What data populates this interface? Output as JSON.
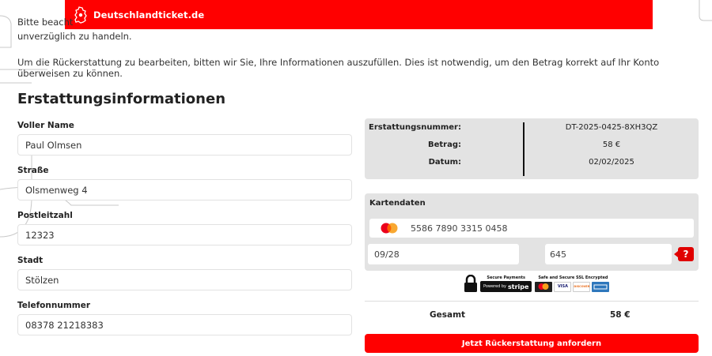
{
  "header": {
    "brand": "Deutschlandticket.de"
  },
  "intro": {
    "line1": "Bitte beacht",
    "line2": "unverzüglich zu handeln.",
    "line3": "Um die Rückerstattung zu bearbeiten, bitten wir Sie, Ihre Informationen auszufüllen. Dies ist notwendig, um den Betrag korrekt auf Ihr Konto überweisen zu können."
  },
  "form": {
    "title": "Erstattungsinformationen",
    "fields": [
      {
        "label": "Voller Name",
        "value": "Paul Olmsen"
      },
      {
        "label": "Straße",
        "value": "Olsmenweg 4"
      },
      {
        "label": "Postleitzahl",
        "value": "12323"
      },
      {
        "label": "Stadt",
        "value": "Stölzen"
      },
      {
        "label": "Telefonnummer",
        "value": "08378 21218383"
      }
    ]
  },
  "summary": {
    "rows": [
      {
        "label": "Erstattungsnummer:",
        "value": "DT-2025-0425-8XH3QZ"
      },
      {
        "label": "Betrag:",
        "value": "58 €"
      },
      {
        "label": "Datum:",
        "value": "02/02/2025"
      }
    ]
  },
  "card": {
    "title": "Kartendaten",
    "number": "5586 7890 3315 0458",
    "expiry": "09/28",
    "cvc": "645",
    "help": "?"
  },
  "badges": {
    "secure_payments": "Secure Payments",
    "powered_by": "Powered by",
    "stripe": "stripe",
    "ssl": "Safe and Secure SSL Encrypted",
    "visa": "VISA",
    "discover": "DISCOVER"
  },
  "total": {
    "label": "Gesamt",
    "value": "58 €"
  },
  "submit": {
    "label": "Jetzt Rückerstattung anfordern"
  },
  "colors": {
    "brand_red": "#ff0000",
    "panel_gray": "#e3e3e3"
  }
}
